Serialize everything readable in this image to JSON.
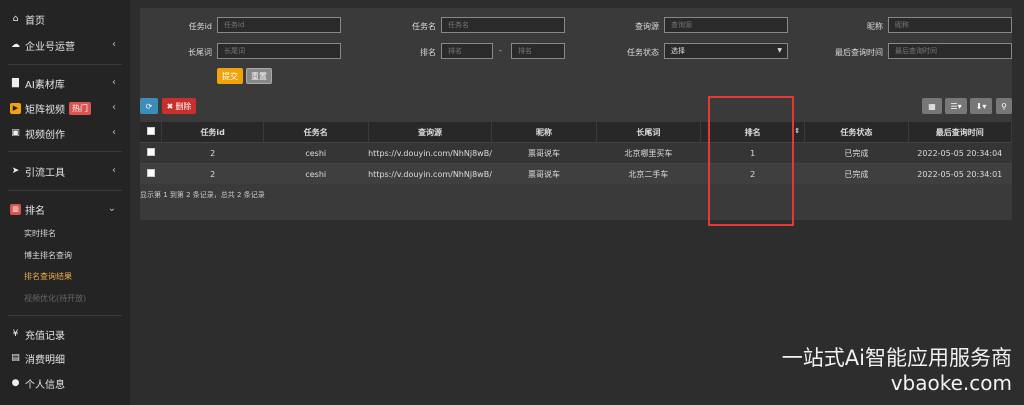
{
  "sidebar": {
    "home": "首页",
    "enterprise": "企业号运营",
    "ai_library": "AI素材库",
    "matrix_video": "矩阵视频",
    "hot_badge": "热门",
    "video_create": "视频创作",
    "traffic_tools": "引流工具",
    "ranking": "排名",
    "ranking_sub": [
      "实时排名",
      "博主排名查询",
      "排名查询结果",
      "视频优化(待开放)"
    ],
    "recharge": "充值记录",
    "consumption": "消费明细",
    "profile": "个人信息"
  },
  "filters": {
    "task_id_label": "任务id",
    "task_id_ph": "任务id",
    "task_name_label": "任务名",
    "task_name_ph": "任务名",
    "source_label": "查询源",
    "source_ph": "查询源",
    "nickname_label": "昵称",
    "nickname_ph": "昵称",
    "longtail_label": "长尾词",
    "longtail_ph": "长尾词",
    "rank_label": "排名",
    "rank_from_ph": "排名",
    "rank_to_ph": "排名",
    "rank_sep": "-",
    "status_label": "任务状态",
    "status_value": "选择",
    "last_query_label": "最后查询时间",
    "last_query_ph": "最后查询时间",
    "submit": "提交",
    "reset": "重置"
  },
  "toolbar": {
    "delete": "删除"
  },
  "table": {
    "headers": [
      "任务id",
      "任务名",
      "查询源",
      "昵称",
      "长尾词",
      "排名",
      "任务状态",
      "最后查询时间"
    ],
    "rows": [
      [
        "2",
        "ceshi",
        "https://v.douyin.com/NhNj8wB/",
        "票哥说车",
        "北京哪里买车",
        "1",
        "已完成",
        "2022-05-05 20:34:04"
      ],
      [
        "2",
        "ceshi",
        "https://v.douyin.com/NhNj8wB/",
        "票哥说车",
        "北京二手车",
        "2",
        "已完成",
        "2022-05-05 20:34:01"
      ]
    ],
    "summary": "显示第 1 到第 2 条记录，总共 2 条记录"
  },
  "watermark": {
    "line1": "一站式Ai智能应用服务商",
    "line2": "vbaoke.com"
  },
  "colors": {
    "accent": "#f0a30a",
    "danger": "#c9302c",
    "primary": "#3c8dbc",
    "highlight": "#e53935"
  }
}
